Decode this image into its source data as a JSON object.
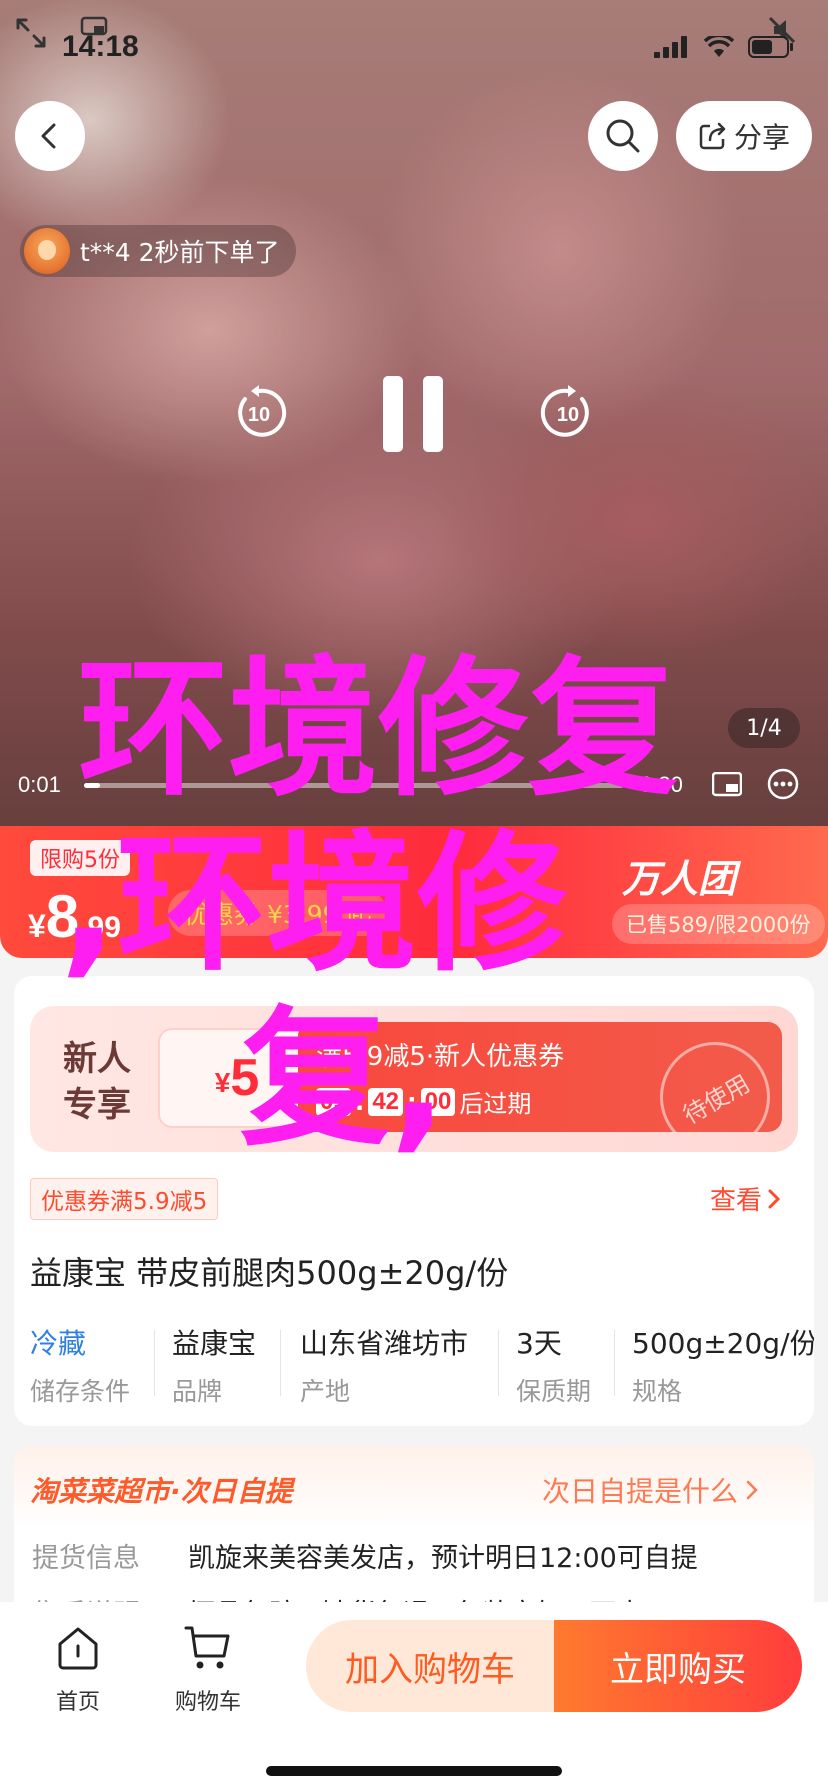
{
  "status_bar": {
    "time": "14:18"
  },
  "header": {
    "share_label": "分享"
  },
  "video": {
    "buyer_notice": "t**4 2秒前下单了",
    "skip_seconds": "10",
    "current_time": "0:01",
    "total_time": "0:30",
    "progress": 0.03,
    "page_indicator": "1/4"
  },
  "price_banner": {
    "limit_tag": "限购5份",
    "currency": "¥",
    "price_int": "8",
    "price_dec": ".99",
    "coupon_price": "优惠券 ¥3.99 起",
    "group_logo": "万人团",
    "group_sub": "已售589/限2000份"
  },
  "new_user": {
    "label_line1": "新人",
    "label_line2": "专享",
    "coupon_symbol": "¥",
    "coupon_value": "5",
    "coupon_title": "满5.9减5·新人优惠券",
    "countdown": [
      "09",
      "42",
      "00"
    ],
    "countdown_suffix": "后过期",
    "stamp": "待使用"
  },
  "coupon_tag": "优惠券满5.9减5",
  "view_link": "查看",
  "product": {
    "title": "益康宝 带皮前腿肉500g±20g/份",
    "attributes": [
      {
        "value": "冷藏",
        "label": "储存条件"
      },
      {
        "value": "益康宝",
        "label": "品牌"
      },
      {
        "value": "山东省潍坊市",
        "label": "产地"
      },
      {
        "value": "3天",
        "label": "保质期"
      },
      {
        "value": "500g±20g/份",
        "label": "规格"
      }
    ]
  },
  "market": {
    "title": "淘菜菜超市·次日自提",
    "link": "次日自提是什么",
    "pickup_label": "提货信息",
    "pickup_value": "凯旋来美容美发店，预计明日12:00可自提",
    "after_label": "售后说明",
    "after_value": "坏品包赔 · 缺货包退 · 包装完好 · 不支"
  },
  "bottom_bar": {
    "home_label": "首页",
    "cart_label": "购物车",
    "add_cart": "加入购物车",
    "buy_now": "立即购买"
  },
  "overlay": {
    "line1": "环境修复",
    "line2": ",环境修",
    "line3": "复,"
  },
  "colors": {
    "accent_red": "#ff2d3a",
    "accent_orange": "#ff5a1f",
    "overlay_magenta": "#ff1ef0",
    "link_blue": "#2f7fe6"
  }
}
